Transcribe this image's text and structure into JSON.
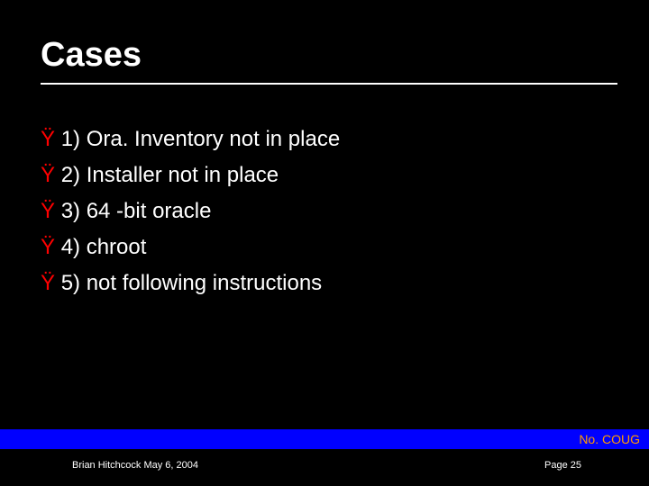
{
  "title": "Cases",
  "bullet_char": "Ÿ",
  "items": [
    "1) Ora. Inventory not in place",
    "2) Installer not in place",
    "3) 64 -bit oracle",
    "4) chroot",
    "5) not following instructions"
  ],
  "bar": {
    "org": "No. COUG"
  },
  "footer": {
    "author": "Brian Hitchcock  May 6, 2004",
    "page": "Page 25"
  }
}
